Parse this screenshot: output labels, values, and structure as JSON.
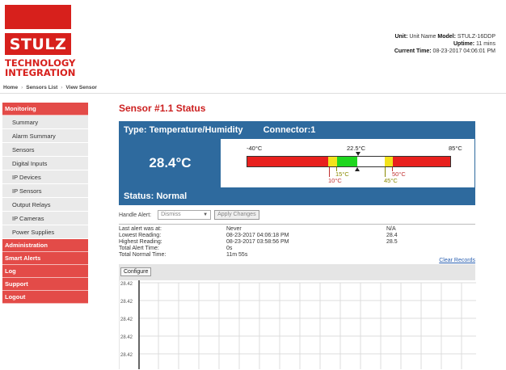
{
  "header": {
    "logo_word": "STULZ",
    "logo_sub": [
      "TECHNOLOGY",
      "INTEGRATION"
    ],
    "unit_label": "Unit:",
    "unit_value": "Unit Name",
    "model_label": "Model:",
    "model_value": "STULZ-16DDP",
    "uptime_label": "Uptime:",
    "uptime_value": "11 mins",
    "current_time_label": "Current Time:",
    "current_time_value": "08-23-2017 04:06:01 PM"
  },
  "breadcrumb": [
    "Home",
    "Sensors List",
    "View Sensor"
  ],
  "sidebar": {
    "monitoring": "Monitoring",
    "items": [
      "Summary",
      "Alarm Summary",
      "Sensors",
      "Digital Inputs",
      "IP Devices",
      "IP Sensors",
      "Output Relays",
      "IP Cameras",
      "Power Supplies"
    ],
    "sections": [
      "Administration",
      "Smart Alerts",
      "Log",
      "Support",
      "Logout"
    ]
  },
  "main": {
    "title": "Sensor #1.1 Status",
    "type_text": "Type: Temperature/Humidity",
    "connector_text": "Connector:1",
    "reading": "28.4°C",
    "status_text": "Status: Normal",
    "scale": {
      "min_label": "-40°C",
      "mid_label": "22.5°C",
      "max_label": "85°C",
      "low_warn_label": "15°C",
      "low_alarm_label": "10°C",
      "high_warn_label": "50°C",
      "high_alarm_label": "45°C"
    },
    "handle_alert_label": "Handle Alert:",
    "handle_alert_value": "Dismiss",
    "apply_label": "Apply Changes",
    "stats": {
      "labels": [
        "Last alert was at:",
        "Lowest Reading:",
        "Highest Reading:",
        "Total Alert Time:",
        "Total Normal Time:"
      ],
      "values": [
        "Never",
        "08-23-2017 04:06:18 PM",
        "08-23-2017 03:58:56 PM",
        "0s",
        "11m 55s"
      ],
      "readings": [
        "N/A",
        "28.4",
        "28.5"
      ]
    },
    "clear_records": "Clear Records",
    "configure": "Configure",
    "chart_ticks": [
      "28.42",
      "28.42",
      "28.42",
      "28.42",
      "28.42"
    ]
  },
  "colors": {
    "brand_red": "#d7201c",
    "header_blue": "#2e6a9e",
    "alarm_red": "#e8201e",
    "warn_yellow": "#f3e21b",
    "ok_green": "#1fd61f"
  }
}
